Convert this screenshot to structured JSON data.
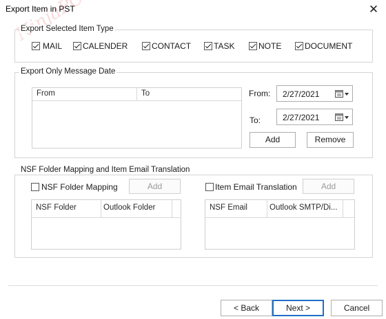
{
  "window": {
    "title": "Export Item in PST",
    "close_glyph": "✕"
  },
  "watermark": "NinjaPC",
  "item_type": {
    "legend": "Export Selected Item Type",
    "items": [
      {
        "label": "MAIL",
        "checked": true
      },
      {
        "label": "CALENDER",
        "checked": true
      },
      {
        "label": "CONTACT",
        "checked": true
      },
      {
        "label": "TASK",
        "checked": true
      },
      {
        "label": "NOTE",
        "checked": true
      },
      {
        "label": "DOCUMENT",
        "checked": true
      }
    ]
  },
  "message_date": {
    "legend": "Export Only Message Date",
    "columns": [
      "From",
      "To"
    ],
    "from_label": "From:",
    "from_value": "2/27/2021",
    "to_label": "To:",
    "to_value": "2/27/2021",
    "add_label": "Add",
    "remove_label": "Remove"
  },
  "nsf_mapping": {
    "legend": "NSF Folder Mapping and Item Email Translation",
    "folder_mapping_label": "NSF Folder Mapping",
    "folder_mapping_checked": false,
    "folder_add_label": "Add",
    "folder_columns": [
      "NSF Folder",
      "Outlook Folder"
    ],
    "email_translation_label": "Item Email Translation",
    "email_translation_checked": false,
    "email_add_label": "Add",
    "email_columns": [
      "NSF Email",
      "Outlook SMTP/Di..."
    ]
  },
  "footer": {
    "back_label": "< Back",
    "next_label": "Next >",
    "cancel_label": "Cancel"
  }
}
